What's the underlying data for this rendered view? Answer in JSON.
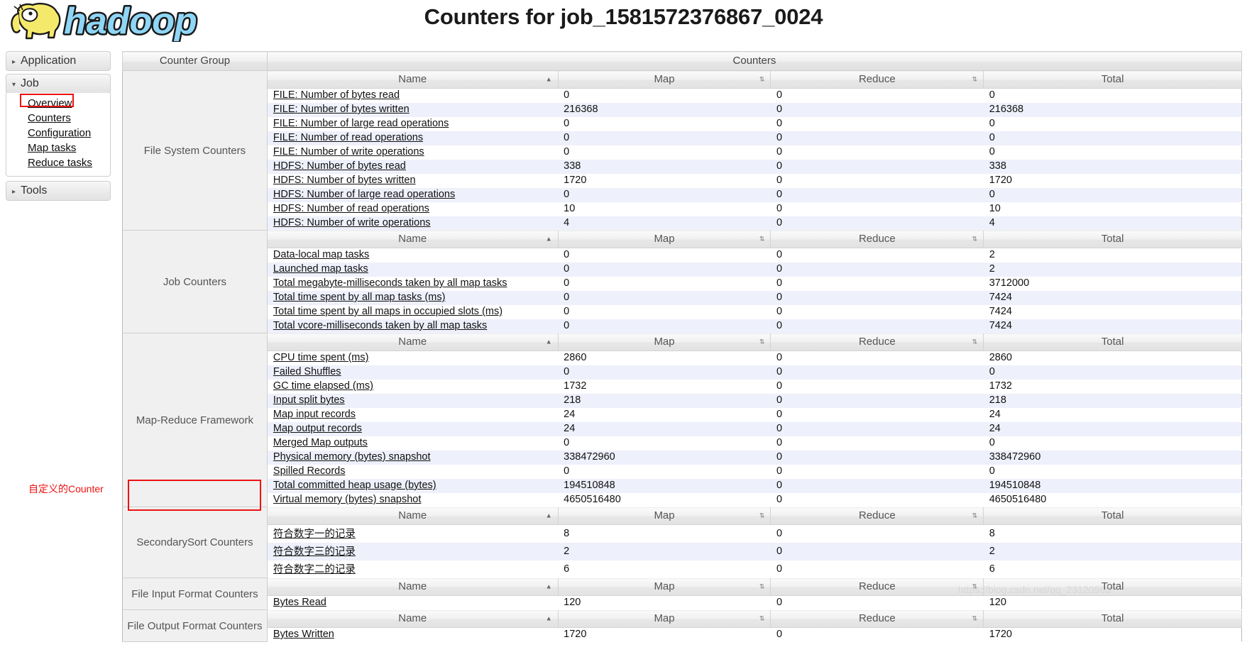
{
  "header": {
    "title": "Counters for job_1581572376867_0024",
    "logo_alt": "hadoop-logo"
  },
  "sidebar": {
    "sections": [
      {
        "label": "Application",
        "expanded": false,
        "triangle": "▸",
        "links": []
      },
      {
        "label": "Job",
        "expanded": true,
        "triangle": "▾",
        "links": [
          "Overview",
          "Counters",
          "Configuration",
          "Map tasks",
          "Reduce tasks"
        ]
      },
      {
        "label": "Tools",
        "expanded": false,
        "triangle": "▸",
        "links": []
      }
    ]
  },
  "annotations": {
    "custom_counter_note": "自定义的Counter",
    "highlight_color": "#ee1111"
  },
  "watermark": "https://blog.csdn.net/qq_23120963",
  "table": {
    "top_headers": {
      "counter_group": "Counter Group",
      "counters": "Counters"
    },
    "column_headers": {
      "name": "Name",
      "map": "Map",
      "reduce": "Reduce",
      "total": "Total"
    },
    "sort_icons": {
      "name": "▲",
      "map": "⇅",
      "reduce": "⇅"
    },
    "groups": [
      {
        "group": "File System Counters",
        "rows": [
          {
            "name": "FILE: Number of bytes read",
            "map": "0",
            "reduce": "0",
            "total": "0"
          },
          {
            "name": "FILE: Number of bytes written",
            "map": "216368",
            "reduce": "0",
            "total": "216368"
          },
          {
            "name": "FILE: Number of large read operations",
            "map": "0",
            "reduce": "0",
            "total": "0"
          },
          {
            "name": "FILE: Number of read operations",
            "map": "0",
            "reduce": "0",
            "total": "0"
          },
          {
            "name": "FILE: Number of write operations",
            "map": "0",
            "reduce": "0",
            "total": "0"
          },
          {
            "name": "HDFS: Number of bytes read",
            "map": "338",
            "reduce": "0",
            "total": "338"
          },
          {
            "name": "HDFS: Number of bytes written",
            "map": "1720",
            "reduce": "0",
            "total": "1720"
          },
          {
            "name": "HDFS: Number of large read operations",
            "map": "0",
            "reduce": "0",
            "total": "0"
          },
          {
            "name": "HDFS: Number of read operations",
            "map": "10",
            "reduce": "0",
            "total": "10"
          },
          {
            "name": "HDFS: Number of write operations",
            "map": "4",
            "reduce": "0",
            "total": "4"
          }
        ]
      },
      {
        "group": "Job Counters",
        "rows": [
          {
            "name": "Data-local map tasks",
            "map": "0",
            "reduce": "0",
            "total": "2"
          },
          {
            "name": "Launched map tasks",
            "map": "0",
            "reduce": "0",
            "total": "2"
          },
          {
            "name": "Total megabyte-milliseconds taken by all map tasks",
            "map": "0",
            "reduce": "0",
            "total": "3712000"
          },
          {
            "name": "Total time spent by all map tasks (ms)",
            "map": "0",
            "reduce": "0",
            "total": "7424"
          },
          {
            "name": "Total time spent by all maps in occupied slots (ms)",
            "map": "0",
            "reduce": "0",
            "total": "7424"
          },
          {
            "name": "Total vcore-milliseconds taken by all map tasks",
            "map": "0",
            "reduce": "0",
            "total": "7424"
          }
        ]
      },
      {
        "group": "Map-Reduce Framework",
        "rows": [
          {
            "name": "CPU time spent (ms)",
            "map": "2860",
            "reduce": "0",
            "total": "2860"
          },
          {
            "name": "Failed Shuffles",
            "map": "0",
            "reduce": "0",
            "total": "0"
          },
          {
            "name": "GC time elapsed (ms)",
            "map": "1732",
            "reduce": "0",
            "total": "1732"
          },
          {
            "name": "Input split bytes",
            "map": "218",
            "reduce": "0",
            "total": "218"
          },
          {
            "name": "Map input records",
            "map": "24",
            "reduce": "0",
            "total": "24"
          },
          {
            "name": "Map output records",
            "map": "24",
            "reduce": "0",
            "total": "24"
          },
          {
            "name": "Merged Map outputs",
            "map": "0",
            "reduce": "0",
            "total": "0"
          },
          {
            "name": "Physical memory (bytes) snapshot",
            "map": "338472960",
            "reduce": "0",
            "total": "338472960"
          },
          {
            "name": "Spilled Records",
            "map": "0",
            "reduce": "0",
            "total": "0"
          },
          {
            "name": "Total committed heap usage (bytes)",
            "map": "194510848",
            "reduce": "0",
            "total": "194510848"
          },
          {
            "name": "Virtual memory (bytes) snapshot",
            "map": "4650516480",
            "reduce": "0",
            "total": "4650516480"
          }
        ]
      },
      {
        "group": "SecondarySort Counters",
        "highlighted": true,
        "rows": [
          {
            "name": "符合数字一的记录",
            "map": "8",
            "reduce": "0",
            "total": "8"
          },
          {
            "name": "符合数字三的记录",
            "map": "2",
            "reduce": "0",
            "total": "2"
          },
          {
            "name": "符合数字二的记录",
            "map": "6",
            "reduce": "0",
            "total": "6"
          }
        ]
      },
      {
        "group": "File Input Format Counters",
        "rows": [
          {
            "name": "Bytes Read",
            "map": "120",
            "reduce": "0",
            "total": "120"
          }
        ]
      },
      {
        "group": "File Output Format Counters",
        "rows": [
          {
            "name": "Bytes Written",
            "map": "1720",
            "reduce": "0",
            "total": "1720"
          }
        ]
      }
    ]
  }
}
